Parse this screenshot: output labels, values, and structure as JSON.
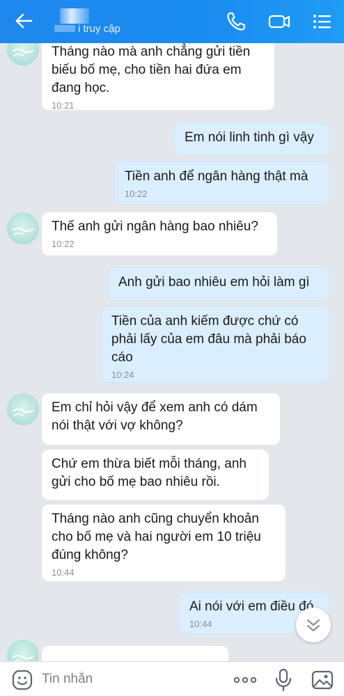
{
  "header": {
    "status": "i truy cập",
    "icons": [
      "back-arrow-icon",
      "phone-icon",
      "video-camera-icon",
      "menu-icon"
    ]
  },
  "messages": [
    {
      "dir": "in",
      "text": "Tháng nào mà anh chẳng gửi tiền\nbiếu bố mẹ, cho tiền hai đứa em\nđang học.",
      "time": "10:21"
    },
    {
      "dir": "out",
      "text": "Em nói linh tinh gì vậy",
      "time": ""
    },
    {
      "dir": "out",
      "text": "Tiền anh để ngân hàng thật mà",
      "time": "10:22"
    },
    {
      "dir": "in",
      "text": "Thế anh gửi ngân hàng bao nhiêu?",
      "time": "10:22"
    },
    {
      "dir": "out",
      "text": "Anh gửi bao nhiêu em hỏi làm gì",
      "time": ""
    },
    {
      "dir": "out",
      "text": "Tiền của anh kiếm được chứ có\nphải lấy của em đâu mà phải báo\ncáo",
      "time": "10:24"
    },
    {
      "dir": "in",
      "text": "Em chỉ hỏi vậy để xem anh có dám\nnói thật với vợ không?",
      "time": ""
    },
    {
      "dir": "in",
      "text": "Chứ em thừa biết mỗi tháng, anh\ngửi cho bố mẹ bao nhiêu rồi.",
      "time": ""
    },
    {
      "dir": "in",
      "text": "Tháng nào anh cũng chuyển khoản\ncho bố mẹ và hai người em 10 triệu\nđúng không?",
      "time": "10:44"
    },
    {
      "dir": "out",
      "text": "Ai nói với em điều đó",
      "time": "10:44"
    }
  ],
  "input": {
    "placeholder": "Tin nhắn",
    "icons": [
      "emoji-icon",
      "more-icon",
      "microphone-icon",
      "image-icon"
    ]
  },
  "colors": {
    "header": "#1a8cf0",
    "outgoing_bubble": "#dbeefe",
    "incoming_bubble": "#ffffff",
    "chat_background": "#e3e7ec"
  }
}
